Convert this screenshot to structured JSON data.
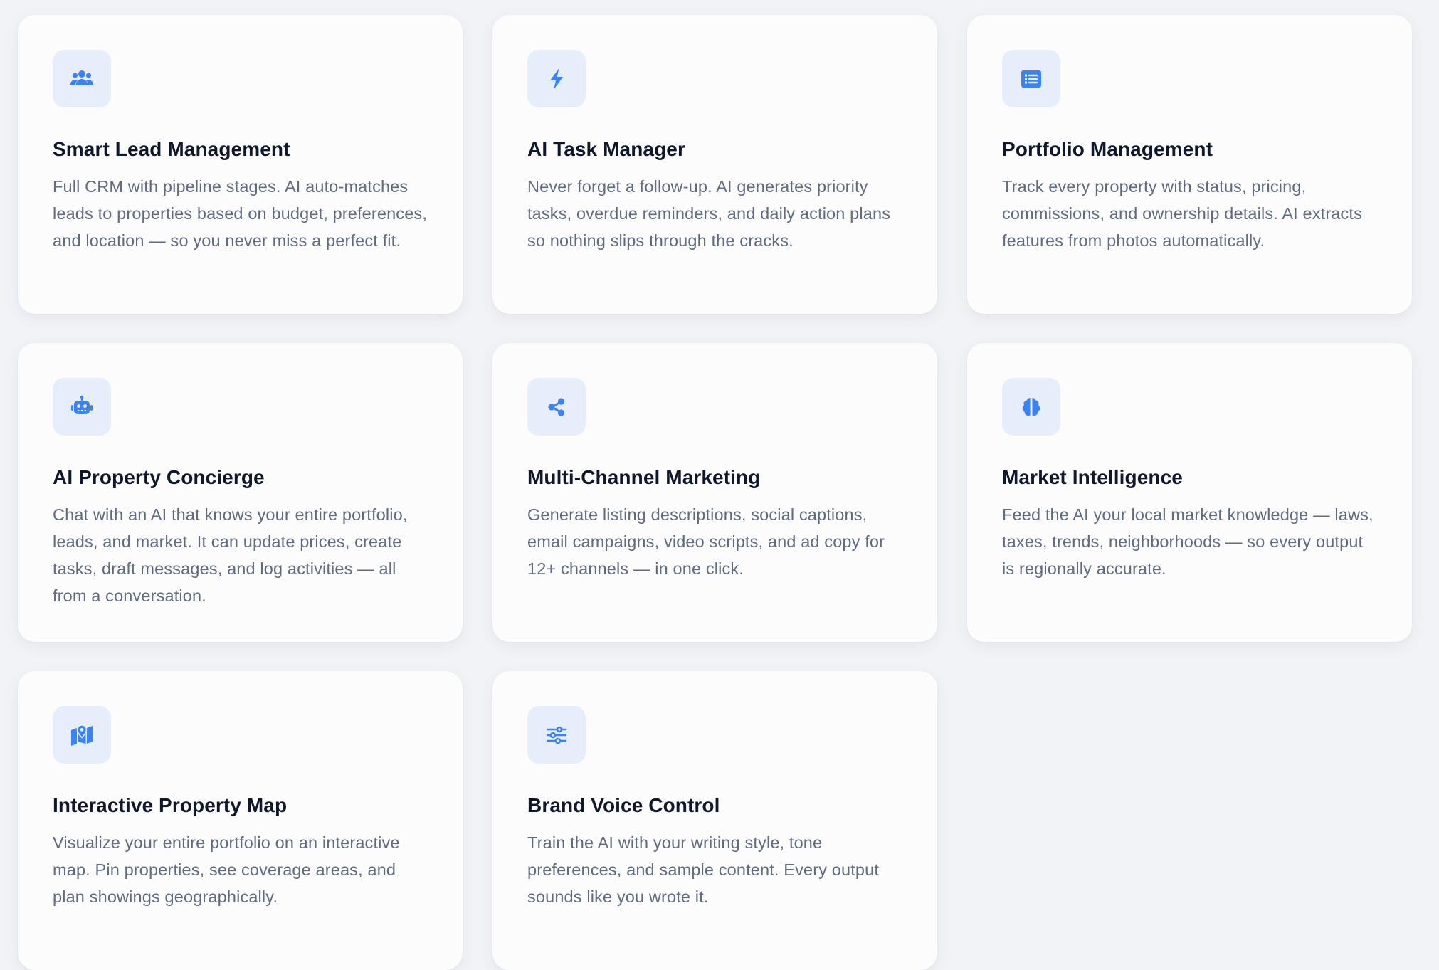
{
  "accent_color": "#3b82f6",
  "features": [
    {
      "icon": "users-icon",
      "title": "Smart Lead Management",
      "description": "Full CRM with pipeline stages. AI auto-matches leads to properties based on budget, preferences, and location — so you never miss a perfect fit."
    },
    {
      "icon": "bolt-icon",
      "title": "AI Task Manager",
      "description": "Never forget a follow-up. AI generates priority tasks, overdue reminders, and daily action plans so nothing slips through the cracks."
    },
    {
      "icon": "list-icon",
      "title": "Portfolio Management",
      "description": "Track every property with status, pricing, commissions, and ownership details. AI extracts features from photos automatically."
    },
    {
      "icon": "robot-icon",
      "title": "AI Property Concierge",
      "description": "Chat with an AI that knows your entire portfolio, leads, and market. It can update prices, create tasks, draft messages, and log activities — all from a conversation."
    },
    {
      "icon": "share-icon",
      "title": "Multi-Channel Marketing",
      "description": "Generate listing descriptions, social captions, email campaigns, video scripts, and ad copy for 12+ channels — in one click."
    },
    {
      "icon": "brain-icon",
      "title": "Market Intelligence",
      "description": "Feed the AI your local market knowledge — laws, taxes, trends, neighborhoods — so every output is regionally accurate."
    },
    {
      "icon": "map-pin-icon",
      "title": "Interactive Property Map",
      "description": "Visualize your entire portfolio on an interactive map. Pin properties, see coverage areas, and plan showings geographically."
    },
    {
      "icon": "sliders-icon",
      "title": "Brand Voice Control",
      "description": "Train the AI with your writing style, tone preferences, and sample content. Every output sounds like you wrote it."
    }
  ]
}
